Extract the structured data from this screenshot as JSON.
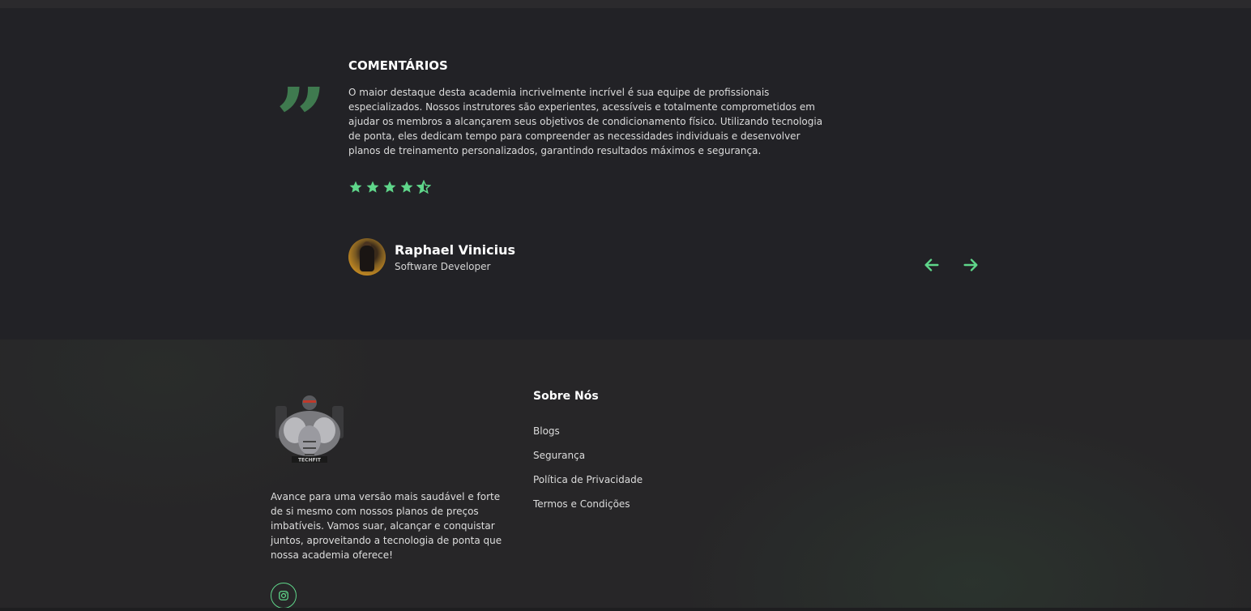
{
  "testimonial": {
    "heading": "COMENTÁRIOS",
    "quote_icon": "quote-icon",
    "text": "O maior destaque desta academia incrivelmente incrível é sua equipe de profissionais especializados. Nossos instrutores são experientes, acessíveis e totalmente comprometidos em ajudar os membros a alcançarem seus objetivos de condicionamento físico. Utilizando tecnologia de ponta, eles dedicam tempo para compreender as necessidades individuais e desenvolver planos de treinamento personalizados, garantindo resultados máximos e segurança.",
    "rating": 4.5,
    "rating_max": 5,
    "author": {
      "name": "Raphael Vinicius",
      "role": "Software Developer"
    },
    "prev_icon": "arrow-left-icon",
    "next_icon": "arrow-right-icon"
  },
  "footer": {
    "about_text": "Avance para uma versão mais saudável e forte de si mesmo com nossos planos de preços imbatíveis. Vamos suar, alcançar e conquistar juntos, aproveitando a tecnologia de ponta que nossa academia oferece!",
    "links_title": "Sobre Nós",
    "links": [
      "Blogs",
      "Segurança",
      "Política de Privacidade",
      "Termos e Condições"
    ],
    "social_icon": "instagram-icon",
    "logo_text": "TECHFIT"
  },
  "colors": {
    "accent": "#5fd68a",
    "quote": "#3f7a4f",
    "background": "#222226",
    "footer_background": "#272628"
  }
}
